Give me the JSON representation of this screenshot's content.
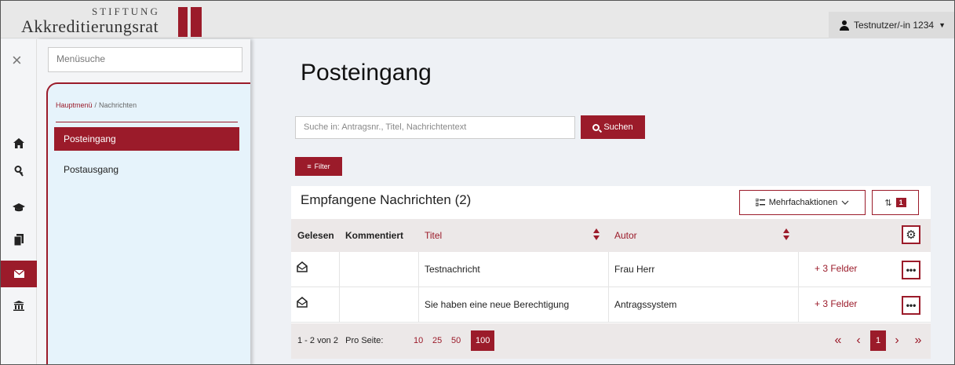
{
  "colors": {
    "accent": "#9b1b2a",
    "menu_bg": "#e6f3fb",
    "page_bg": "#eef1f5"
  },
  "header": {
    "logo_top": "STIFTUNG",
    "logo_name": "Akkreditierungsrat",
    "user": "Testnutzer/-in 1234"
  },
  "rail": {
    "icons": [
      "close-icon",
      "home-icon",
      "key-icon",
      "graduation-cap-icon",
      "documents-icon",
      "envelope-icon",
      "institution-icon"
    ],
    "active": "envelope-icon"
  },
  "menu": {
    "search_placeholder": "Menüsuche",
    "breadcrumb_root": "Hauptmenü",
    "breadcrumb_sep": "/",
    "breadcrumb_current": "Nachrichten",
    "items": [
      {
        "label": "Posteingang",
        "active": true
      },
      {
        "label": "Postausgang",
        "active": false
      }
    ]
  },
  "main": {
    "title": "Posteingang",
    "search_placeholder": "Suche in: Antragsnr., Titel, Nachrichtentext",
    "search_button": "Suchen",
    "filter_button": "Filter",
    "list_title": "Empfangene Nachrichten (2)",
    "multi_button": "Mehrfachaktionen",
    "sort_count": "1",
    "columns": {
      "read": "Gelesen",
      "commented": "Kommentiert",
      "title": "Titel",
      "author": "Autor"
    },
    "rows": [
      {
        "title": "Testnachricht",
        "author": "Frau Herr",
        "extra": "+  3 Felder",
        "actions": "•••"
      },
      {
        "title": "Sie haben eine neue Berechtigung",
        "author": "Antragssystem",
        "extra": "+  3 Felder",
        "actions": "•••"
      }
    ],
    "pagination": {
      "range": "1 - 2 von 2",
      "per_page_label": "Pro Seite:",
      "per_page_options": [
        "10",
        "25",
        "50",
        "100"
      ],
      "per_page_selected": "100",
      "first": "«",
      "prev": "‹",
      "page": "1",
      "next": "›",
      "last": "»"
    }
  }
}
